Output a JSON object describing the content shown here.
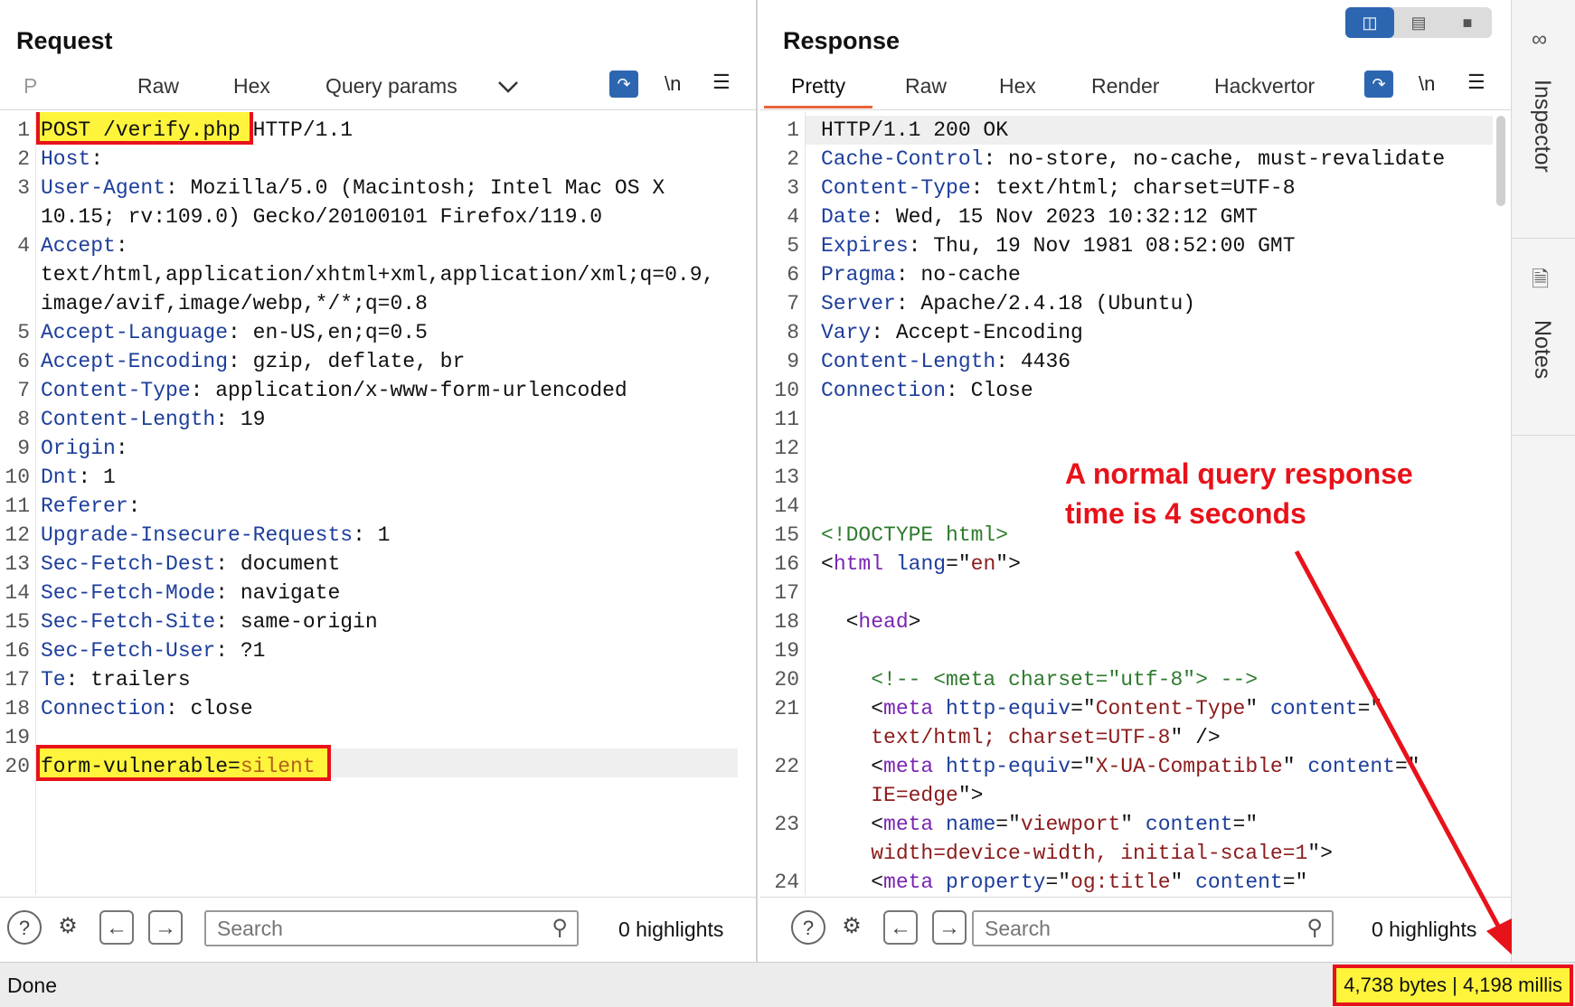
{
  "request": {
    "title": "Request",
    "tabs": [
      "P",
      "Raw",
      "Hex",
      "Query params"
    ],
    "newline_label": "\\n",
    "lines": [
      {
        "n": "1",
        "segs": [
          {
            "t": "POST /verify.php",
            "c": "plain"
          },
          {
            "t": " HTTP/1.1",
            "c": "plain"
          }
        ]
      },
      {
        "n": "2",
        "segs": [
          {
            "t": "Host",
            "c": "hk"
          },
          {
            "t": ":",
            "c": "plain"
          }
        ]
      },
      {
        "n": "3",
        "segs": [
          {
            "t": "User-Agent",
            "c": "hk"
          },
          {
            "t": ": Mozilla/5.0 (Macintosh; Intel Mac OS X",
            "c": "plain"
          }
        ]
      },
      {
        "n": "",
        "segs": [
          {
            "t": "10.15; rv:109.0) Gecko/20100101 Firefox/119.0",
            "c": "plain"
          }
        ]
      },
      {
        "n": "4",
        "segs": [
          {
            "t": "Accept",
            "c": "hk"
          },
          {
            "t": ":",
            "c": "plain"
          }
        ]
      },
      {
        "n": "",
        "segs": [
          {
            "t": "text/html,application/xhtml+xml,application/xml;q=0.9,",
            "c": "plain"
          }
        ]
      },
      {
        "n": "",
        "segs": [
          {
            "t": "image/avif,image/webp,*/*;q=0.8",
            "c": "plain"
          }
        ]
      },
      {
        "n": "5",
        "segs": [
          {
            "t": "Accept-Language",
            "c": "hk"
          },
          {
            "t": ": en-US,en;q=0.5",
            "c": "plain"
          }
        ]
      },
      {
        "n": "6",
        "segs": [
          {
            "t": "Accept-Encoding",
            "c": "hk"
          },
          {
            "t": ": gzip, deflate, br",
            "c": "plain"
          }
        ]
      },
      {
        "n": "7",
        "segs": [
          {
            "t": "Content-Type",
            "c": "hk"
          },
          {
            "t": ": application/x-www-form-urlencoded",
            "c": "plain"
          }
        ]
      },
      {
        "n": "8",
        "segs": [
          {
            "t": "Content-Length",
            "c": "hk"
          },
          {
            "t": ": 19",
            "c": "plain"
          }
        ]
      },
      {
        "n": "9",
        "segs": [
          {
            "t": "Origin",
            "c": "hk"
          },
          {
            "t": ":",
            "c": "plain"
          }
        ]
      },
      {
        "n": "10",
        "segs": [
          {
            "t": "Dnt",
            "c": "hk"
          },
          {
            "t": ": 1",
            "c": "plain"
          }
        ]
      },
      {
        "n": "11",
        "segs": [
          {
            "t": "Referer",
            "c": "hk"
          },
          {
            "t": ":",
            "c": "plain"
          }
        ]
      },
      {
        "n": "12",
        "segs": [
          {
            "t": "Upgrade-Insecure-Requests",
            "c": "hk"
          },
          {
            "t": ": 1",
            "c": "plain"
          }
        ]
      },
      {
        "n": "13",
        "segs": [
          {
            "t": "Sec-Fetch-Dest",
            "c": "hk"
          },
          {
            "t": ": document",
            "c": "plain"
          }
        ]
      },
      {
        "n": "14",
        "segs": [
          {
            "t": "Sec-Fetch-Mode",
            "c": "hk"
          },
          {
            "t": ": navigate",
            "c": "plain"
          }
        ]
      },
      {
        "n": "15",
        "segs": [
          {
            "t": "Sec-Fetch-Site",
            "c": "hk"
          },
          {
            "t": ": same-origin",
            "c": "plain"
          }
        ]
      },
      {
        "n": "16",
        "segs": [
          {
            "t": "Sec-Fetch-User",
            "c": "hk"
          },
          {
            "t": ": ?1",
            "c": "plain"
          }
        ]
      },
      {
        "n": "17",
        "segs": [
          {
            "t": "Te",
            "c": "hk"
          },
          {
            "t": ": trailers",
            "c": "plain"
          }
        ]
      },
      {
        "n": "18",
        "segs": [
          {
            "t": "Connection",
            "c": "hk"
          },
          {
            "t": ": close",
            "c": "plain"
          }
        ]
      },
      {
        "n": "19",
        "segs": []
      },
      {
        "n": "20",
        "segs": [
          {
            "t": "form-vulnerable=",
            "c": "plain"
          },
          {
            "t": "silent",
            "c": "pv"
          }
        ]
      }
    ],
    "search_placeholder": "Search",
    "highlights": "0 highlights"
  },
  "response": {
    "title": "Response",
    "tabs": [
      "Pretty",
      "Raw",
      "Hex",
      "Render",
      "Hackvertor"
    ],
    "newline_label": "\\n",
    "lines": [
      {
        "n": "1",
        "segs": [
          {
            "t": "HTTP/1.1 200 OK",
            "c": "plain"
          }
        ]
      },
      {
        "n": "2",
        "segs": [
          {
            "t": "Cache-Control",
            "c": "hk"
          },
          {
            "t": ": no-store, no-cache, must-revalidate",
            "c": "plain"
          }
        ]
      },
      {
        "n": "3",
        "segs": [
          {
            "t": "Content-Type",
            "c": "hk"
          },
          {
            "t": ": text/html; charset=UTF-8",
            "c": "plain"
          }
        ]
      },
      {
        "n": "4",
        "segs": [
          {
            "t": "Date",
            "c": "hk"
          },
          {
            "t": ": Wed, 15 Nov 2023 10:32:12 GMT",
            "c": "plain"
          }
        ]
      },
      {
        "n": "5",
        "segs": [
          {
            "t": "Expires",
            "c": "hk"
          },
          {
            "t": ": Thu, 19 Nov 1981 08:52:00 GMT",
            "c": "plain"
          }
        ]
      },
      {
        "n": "6",
        "segs": [
          {
            "t": "Pragma",
            "c": "hk"
          },
          {
            "t": ": no-cache",
            "c": "plain"
          }
        ]
      },
      {
        "n": "7",
        "segs": [
          {
            "t": "Server",
            "c": "hk"
          },
          {
            "t": ": Apache/2.4.18 (Ubuntu)",
            "c": "plain"
          }
        ]
      },
      {
        "n": "8",
        "segs": [
          {
            "t": "Vary",
            "c": "hk"
          },
          {
            "t": ": Accept-Encoding",
            "c": "plain"
          }
        ]
      },
      {
        "n": "9",
        "segs": [
          {
            "t": "Content-Length",
            "c": "hk"
          },
          {
            "t": ": 4436",
            "c": "plain"
          }
        ]
      },
      {
        "n": "10",
        "segs": [
          {
            "t": "Connection",
            "c": "hk"
          },
          {
            "t": ": Close",
            "c": "plain"
          }
        ]
      },
      {
        "n": "11",
        "segs": []
      },
      {
        "n": "12",
        "segs": []
      },
      {
        "n": "13",
        "segs": []
      },
      {
        "n": "14",
        "segs": []
      },
      {
        "n": "15",
        "segs": [
          {
            "t": "<!DOCTYPE html>",
            "c": "cm"
          }
        ]
      },
      {
        "n": "16",
        "segs": [
          {
            "t": "<",
            "c": "plain"
          },
          {
            "t": "html",
            "c": "tg"
          },
          {
            "t": " ",
            "c": "plain"
          },
          {
            "t": "lang",
            "c": "at"
          },
          {
            "t": "=\"",
            "c": "plain"
          },
          {
            "t": "en",
            "c": "sv"
          },
          {
            "t": "\">",
            "c": "plain"
          }
        ]
      },
      {
        "n": "17",
        "segs": []
      },
      {
        "n": "18",
        "segs": [
          {
            "t": "  <",
            "c": "plain"
          },
          {
            "t": "head",
            "c": "tg"
          },
          {
            "t": ">",
            "c": "plain"
          }
        ]
      },
      {
        "n": "19",
        "segs": []
      },
      {
        "n": "20",
        "segs": [
          {
            "t": "    <!-- <meta charset=\"utf-8\"> -->",
            "c": "cm"
          }
        ]
      },
      {
        "n": "21",
        "segs": [
          {
            "t": "    <",
            "c": "plain"
          },
          {
            "t": "meta",
            "c": "tg"
          },
          {
            "t": " ",
            "c": "plain"
          },
          {
            "t": "http-equiv",
            "c": "at"
          },
          {
            "t": "=\"",
            "c": "plain"
          },
          {
            "t": "Content-Type",
            "c": "sv"
          },
          {
            "t": "\" ",
            "c": "plain"
          },
          {
            "t": "content",
            "c": "at"
          },
          {
            "t": "=\"",
            "c": "plain"
          }
        ]
      },
      {
        "n": "",
        "segs": [
          {
            "t": "    text/html; charset=UTF-8",
            "c": "sv"
          },
          {
            "t": "\" />",
            "c": "plain"
          }
        ]
      },
      {
        "n": "22",
        "segs": [
          {
            "t": "    <",
            "c": "plain"
          },
          {
            "t": "meta",
            "c": "tg"
          },
          {
            "t": " ",
            "c": "plain"
          },
          {
            "t": "http-equiv",
            "c": "at"
          },
          {
            "t": "=\"",
            "c": "plain"
          },
          {
            "t": "X-UA-Compatible",
            "c": "sv"
          },
          {
            "t": "\" ",
            "c": "plain"
          },
          {
            "t": "content",
            "c": "at"
          },
          {
            "t": "=\"",
            "c": "plain"
          }
        ]
      },
      {
        "n": "",
        "segs": [
          {
            "t": "    IE=edge",
            "c": "sv"
          },
          {
            "t": "\">",
            "c": "plain"
          }
        ]
      },
      {
        "n": "23",
        "segs": [
          {
            "t": "    <",
            "c": "plain"
          },
          {
            "t": "meta",
            "c": "tg"
          },
          {
            "t": " ",
            "c": "plain"
          },
          {
            "t": "name",
            "c": "at"
          },
          {
            "t": "=\"",
            "c": "plain"
          },
          {
            "t": "viewport",
            "c": "sv"
          },
          {
            "t": "\" ",
            "c": "plain"
          },
          {
            "t": "content",
            "c": "at"
          },
          {
            "t": "=\"",
            "c": "plain"
          }
        ]
      },
      {
        "n": "",
        "segs": [
          {
            "t": "    width=device-width, initial-scale=1",
            "c": "sv"
          },
          {
            "t": "\">",
            "c": "plain"
          }
        ]
      },
      {
        "n": "24",
        "segs": [
          {
            "t": "    <",
            "c": "plain"
          },
          {
            "t": "meta",
            "c": "tg"
          },
          {
            "t": " ",
            "c": "plain"
          },
          {
            "t": "property",
            "c": "at"
          },
          {
            "t": "=\"",
            "c": "plain"
          },
          {
            "t": "og:title",
            "c": "sv"
          },
          {
            "t": "\" ",
            "c": "plain"
          },
          {
            "t": "content",
            "c": "at"
          },
          {
            "t": "=\"",
            "c": "plain"
          }
        ]
      }
    ],
    "search_placeholder": "Search",
    "highlights": "0 highlights"
  },
  "annotation": {
    "note": "A normal query response time is 4 seconds",
    "color": "#e8121a"
  },
  "status": {
    "left": "Done",
    "stats": "4,738 bytes | 4,198 millis"
  },
  "sidebar": {
    "items": [
      "Inspector",
      "Notes"
    ]
  },
  "icons": {
    "wrap": "wrap-lines-icon",
    "menu": "hamburger-menu-icon",
    "help": "help-icon",
    "settings": "gear-icon",
    "back": "arrow-left-icon",
    "forward": "arrow-right-icon",
    "search": "search-icon",
    "dropdown": "chevron-down-icon"
  },
  "colors": {
    "accent": "#2d66b0",
    "tab_underline": "#e8643c",
    "highlight": "#fff43c",
    "annotation": "#e8121a"
  }
}
